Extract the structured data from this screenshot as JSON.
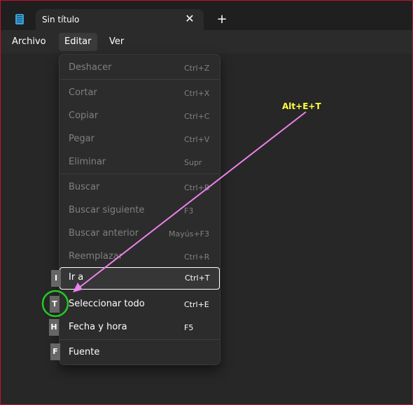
{
  "window": {
    "tab_title": "Sin título",
    "tab_close": "✕",
    "new_tab": "+"
  },
  "menubar": {
    "items": [
      "Archivo",
      "Editar",
      "Ver"
    ],
    "active": "Editar"
  },
  "edit_menu": {
    "items": [
      {
        "label": "Deshacer",
        "shortcut": "Ctrl+Z",
        "enabled": false
      },
      {
        "label": "Cortar",
        "shortcut": "Ctrl+X",
        "enabled": false
      },
      {
        "label": "Copiar",
        "shortcut": "Ctrl+C",
        "enabled": false
      },
      {
        "label": "Pegar",
        "shortcut": "Ctrl+V",
        "enabled": false
      },
      {
        "label": "Eliminar",
        "shortcut": "Supr",
        "enabled": false
      },
      {
        "label": "Buscar",
        "shortcut": "Ctrl+B",
        "enabled": false
      },
      {
        "label": "Buscar siguiente",
        "shortcut": "F3",
        "enabled": false
      },
      {
        "label": "Buscar anterior",
        "shortcut": "Mayús+F3",
        "enabled": false
      },
      {
        "label": "Reemplazar",
        "shortcut": "Ctrl+R",
        "enabled": false
      },
      {
        "label": "Ir a",
        "shortcut": "Ctrl+T",
        "enabled": true,
        "focused": true
      },
      {
        "label": "Seleccionar todo",
        "shortcut": "Ctrl+E",
        "enabled": true
      },
      {
        "label": "Fecha y hora",
        "shortcut": "F5",
        "enabled": true
      },
      {
        "label": "Fuente",
        "shortcut": "",
        "enabled": true
      }
    ]
  },
  "keytips": [
    "I",
    "T",
    "H",
    "F"
  ],
  "annotation": {
    "text": "Alt+E+T",
    "text_color": "#ffff3d",
    "arrow_color": "#ee82ee",
    "circle_color": "#22cc22"
  }
}
